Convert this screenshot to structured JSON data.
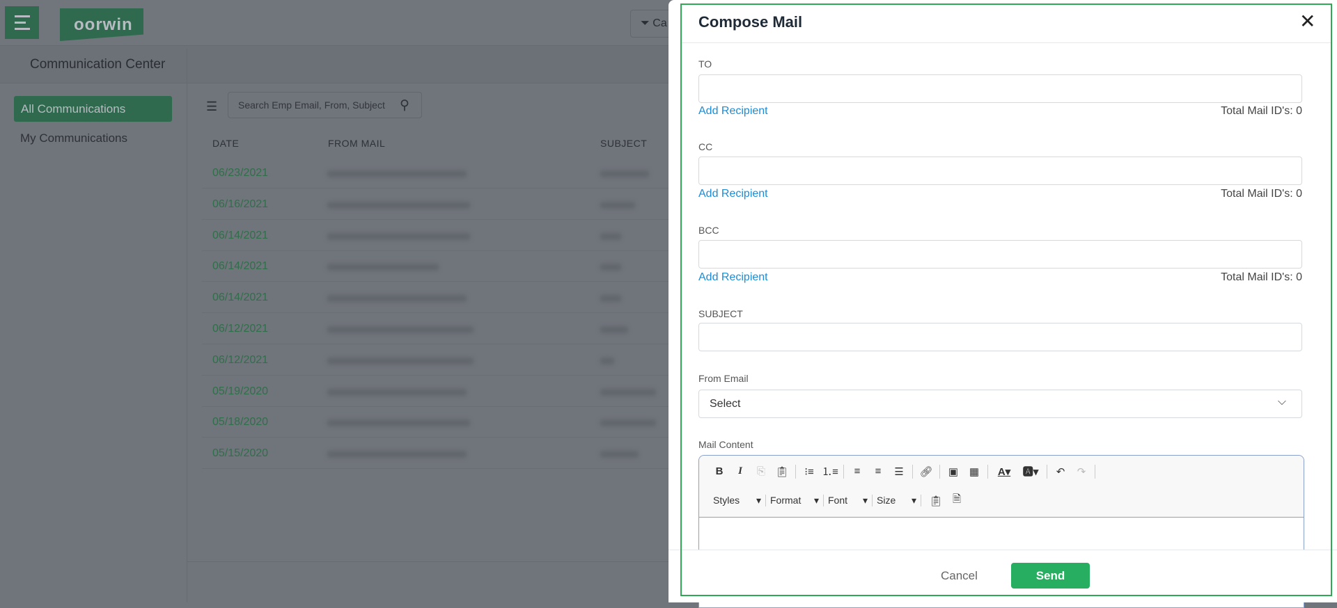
{
  "app": {
    "logo": "oorwin",
    "filter_label": "Ca",
    "section_title": "Communication Center"
  },
  "sidebar": {
    "items": [
      {
        "label": "All Communications",
        "active": true
      },
      {
        "label": "My Communications",
        "active": false
      }
    ]
  },
  "search": {
    "placeholder": "Search Emp Email, From, Subject"
  },
  "table": {
    "headers": [
      "DATE",
      "FROM MAIL",
      "SUBJECT"
    ],
    "rows": [
      {
        "date": "06/23/2021"
      },
      {
        "date": "06/16/2021"
      },
      {
        "date": "06/14/2021"
      },
      {
        "date": "06/14/2021"
      },
      {
        "date": "06/14/2021"
      },
      {
        "date": "06/12/2021"
      },
      {
        "date": "06/12/2021"
      },
      {
        "date": "05/19/2020"
      },
      {
        "date": "05/18/2020"
      },
      {
        "date": "05/15/2020"
      }
    ]
  },
  "modal": {
    "title": "Compose Mail",
    "to": {
      "label": "TO",
      "value": "",
      "add": "Add Recipient",
      "total": "Total Mail ID's: 0"
    },
    "cc": {
      "label": "CC",
      "value": "",
      "add": "Add Recipient",
      "total": "Total Mail ID's: 0"
    },
    "bcc": {
      "label": "BCC",
      "value": "",
      "add": "Add Recipient",
      "total": "Total Mail ID's: 0"
    },
    "subject": {
      "label": "SUBJECT",
      "value": ""
    },
    "from": {
      "label": "From Email",
      "selected": "Select"
    },
    "content": {
      "label": "Mail Content",
      "combos": [
        "Styles",
        "Format",
        "Font",
        "Size"
      ]
    },
    "cancel": "Cancel",
    "send": "Send"
  },
  "colors": {
    "brand": "#2e9a5a",
    "send": "#27ae60",
    "link": "#1a8cd8",
    "highlight_border": "#2eaa55"
  }
}
